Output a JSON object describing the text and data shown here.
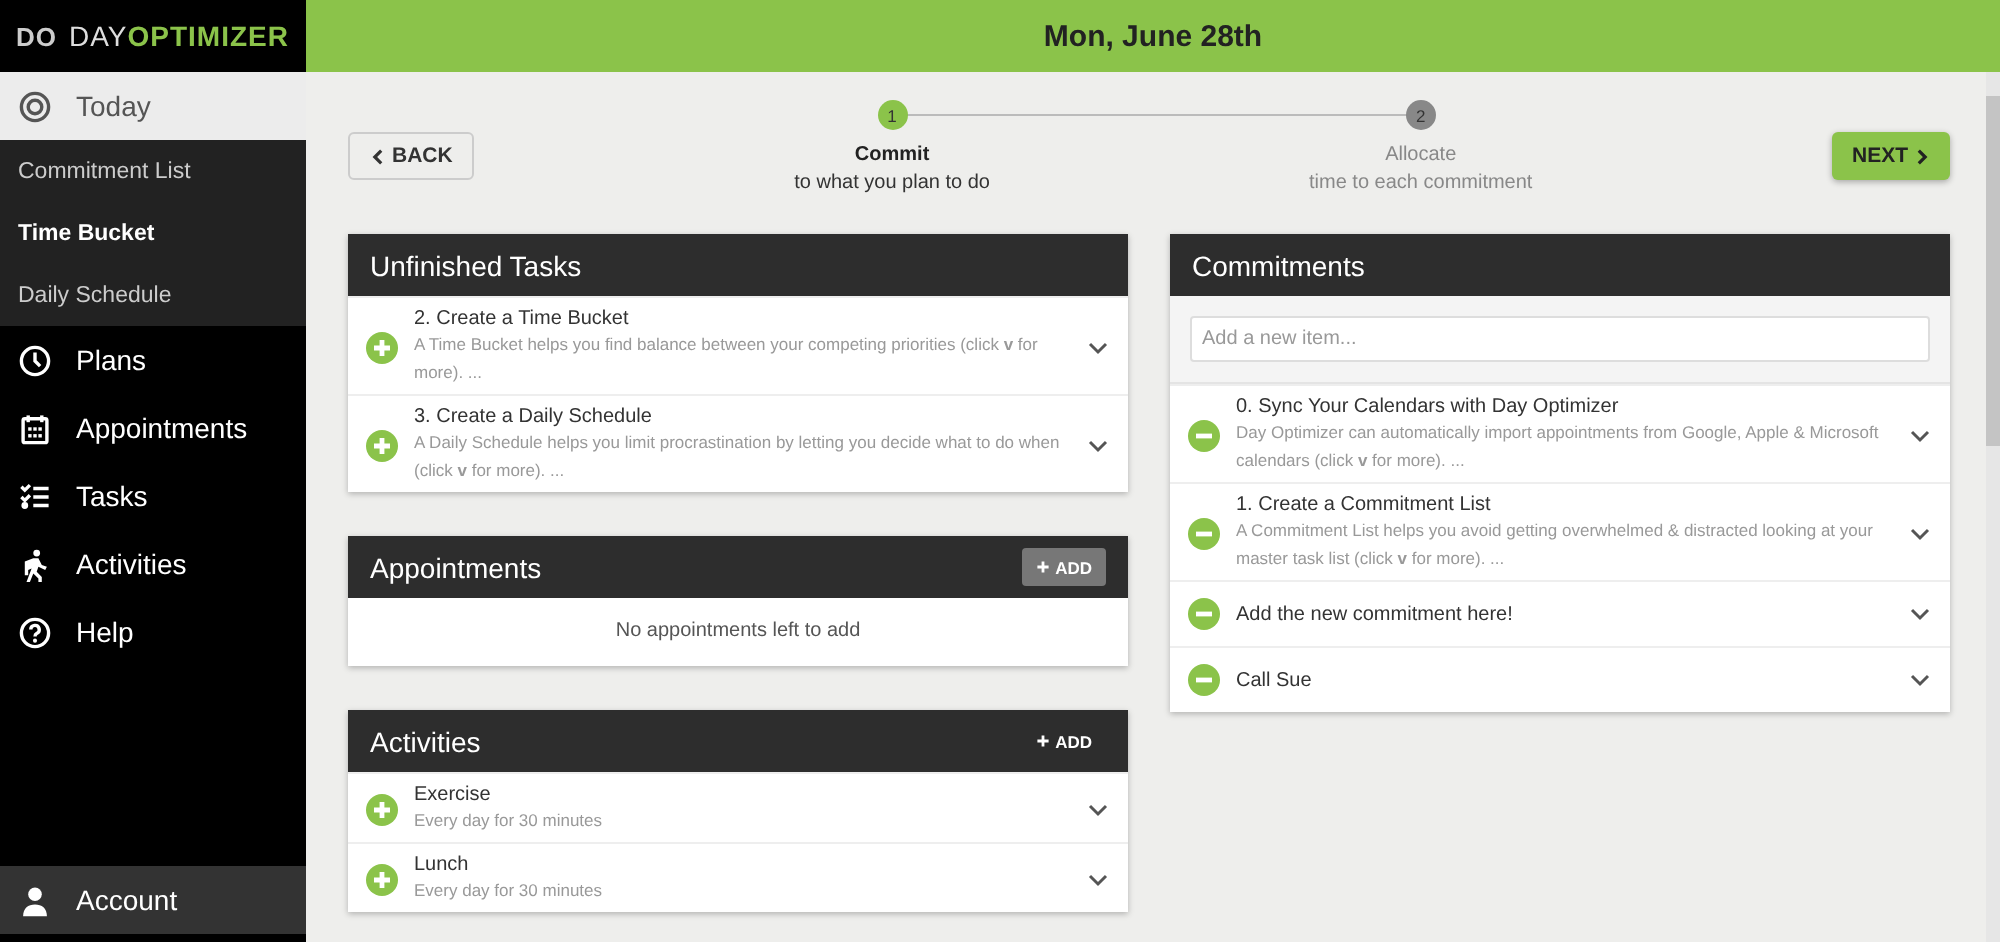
{
  "logo": {
    "mark": "DO",
    "word_light": "DAY",
    "word_bold": "OPTIMIZER"
  },
  "header": {
    "date": "Mon, June 28th"
  },
  "sidebar": {
    "items": [
      {
        "label": "Today",
        "kind": "main",
        "selected": true
      },
      {
        "label": "Commitment List",
        "kind": "sub",
        "selected": false
      },
      {
        "label": "Time Bucket",
        "kind": "sub",
        "selected": true
      },
      {
        "label": "Daily Schedule",
        "kind": "sub",
        "selected": false
      },
      {
        "label": "Plans",
        "kind": "main",
        "selected": false
      },
      {
        "label": "Appointments",
        "kind": "main",
        "selected": false
      },
      {
        "label": "Tasks",
        "kind": "main",
        "selected": false
      },
      {
        "label": "Activities",
        "kind": "main",
        "selected": false
      },
      {
        "label": "Help",
        "kind": "main",
        "selected": false
      }
    ],
    "account": {
      "label": "Account"
    }
  },
  "back_button": "BACK",
  "next_button": "NEXT",
  "steps": [
    {
      "number": "1",
      "title": "Commit",
      "subtitle": "to what you plan to do",
      "selected": true
    },
    {
      "number": "2",
      "title": "Allocate",
      "subtitle": "time to each commitment",
      "selected": false
    }
  ],
  "left_sections": [
    {
      "title": "Unfinished Tasks",
      "items": [
        {
          "title": "2. Create a Time Bucket",
          "description": "A Time Bucket helps you find balance between your competing priorities (click **v** for more). ..."
        },
        {
          "title": "3. Create a Daily Schedule",
          "description": "A Daily Schedule helps you limit procrastination by letting you decide what to do when (click **v** for more). ..."
        }
      ]
    },
    {
      "title": "Appointments",
      "add_button": {
        "label": "ADD",
        "hovered": true
      },
      "empty_text": "No appointments left to add"
    },
    {
      "title": "Activities",
      "add_button": {
        "label": "ADD",
        "hovered": false
      },
      "items": [
        {
          "title": "Exercise",
          "description": "Every day for 30 minutes"
        },
        {
          "title": "Lunch",
          "description": "Every day for 30 minutes"
        }
      ]
    }
  ],
  "commitments": {
    "title": "Commitments",
    "input": {
      "placeholder": "Add a new item..."
    },
    "items": [
      {
        "title": "0. Sync Your Calendars with Day Optimizer",
        "description": "Day Optimizer can automatically import appointments from Google, Apple & Microsoft calendars (click **v** for more). ..."
      },
      {
        "title": "1. Create a Commitment List",
        "description": "A Commitment List helps you avoid getting overwhelmed & distracted looking at your master task list (click **v** for more). ..."
      },
      {
        "title": "Add the new commitment here!"
      },
      {
        "title": "Call Sue"
      }
    ]
  }
}
